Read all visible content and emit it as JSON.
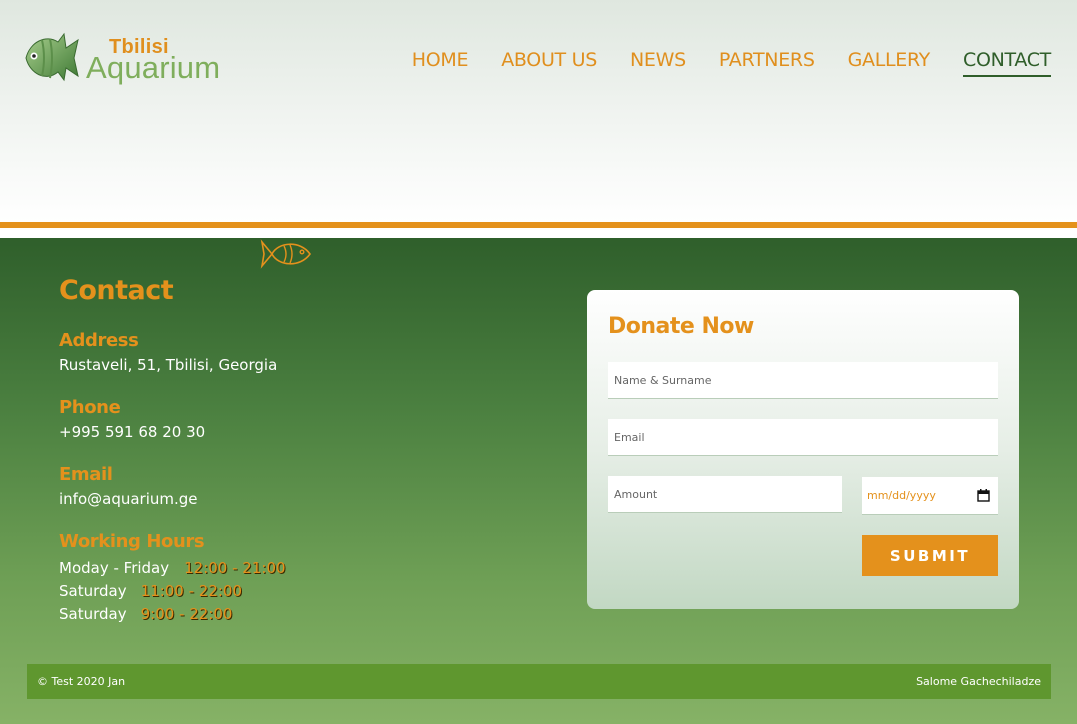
{
  "logo": {
    "line1": "Tbilisi",
    "line2": "Aquarium",
    "icon": "fish-logo-icon"
  },
  "nav": {
    "items": [
      {
        "label": "HOME"
      },
      {
        "label": "ABOUT US"
      },
      {
        "label": "NEWS"
      },
      {
        "label": "PARTNERS"
      },
      {
        "label": "GALLERY"
      },
      {
        "label": "CONTACT",
        "active": true
      }
    ]
  },
  "contact": {
    "title": "Contact",
    "address_label": "Address",
    "address_value": "Rustaveli, 51, Tbilisi, Georgia",
    "phone_label": "Phone",
    "phone_value": "+995 591 68 20 30",
    "email_label": "Email",
    "email_value": "info@aquarium.ge",
    "hours_label": "Working Hours",
    "hours": [
      {
        "days": "Moday - Friday",
        "time": "12:00 - 21:00"
      },
      {
        "days": "Saturday",
        "time": "11:00 - 22:00"
      },
      {
        "days": "Saturday",
        "time": "9:00 - 22:00"
      }
    ]
  },
  "donate": {
    "title": "Donate Now",
    "name_placeholder": "Name & Surname",
    "email_placeholder": "Email",
    "amount_placeholder": "Amount",
    "date_placeholder": "mm/dd/yyyy",
    "submit_label": "SUBMIT"
  },
  "footer": {
    "left": "© Test 2020 Jan",
    "right": "Salome Gachechiladze"
  },
  "colors": {
    "accent": "#e4911c",
    "dark_green": "#2f5e2a",
    "footer_green": "#5f972f"
  }
}
